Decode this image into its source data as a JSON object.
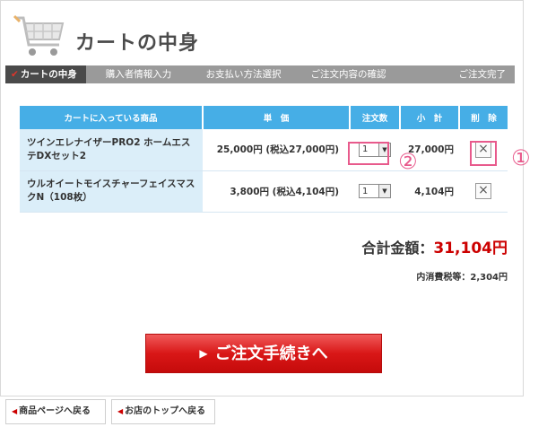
{
  "header": {
    "title": "カートの中身"
  },
  "steps": [
    {
      "label": "カートの中身",
      "active": true
    },
    {
      "label": "購入者情報入力"
    },
    {
      "label": "お支払い方法選択"
    },
    {
      "label": "ご注文内容の確認"
    },
    {
      "label": "ご注文完了"
    }
  ],
  "table": {
    "headers": {
      "product": "カートに入っている商品",
      "unit_price": "単　価",
      "quantity": "注文数",
      "subtotal": "小　計",
      "delete": "削　除"
    },
    "rows": [
      {
        "name": "ツインエレナイザーPRO2 ホームエステDXセット2",
        "price": "25,000円 (税込27,000円)",
        "qty": "1",
        "subtotal": "27,000円"
      },
      {
        "name": "ウルオイートモイスチャーフェイスマスクN（108枚）",
        "price": "3,800円 (税込4,104円)",
        "qty": "1",
        "subtotal": "4,104円"
      }
    ]
  },
  "annotations": {
    "delete_marker": "①",
    "qty_marker": "②"
  },
  "summary": {
    "total_label": "合計金額：",
    "total_value": "31,104円",
    "tax_label": "内消費税等：",
    "tax_value": "2,304円"
  },
  "checkout_button": "ご注文手続きへ",
  "footer_links": {
    "back_product": "商品ページへ戻る",
    "back_top": "お店のトップへ戻る"
  },
  "colors": {
    "header_blue": "#46aee6",
    "name_cell": "#dbeef9",
    "total_red": "#cc0000",
    "highlight_pink": "#e85a8c"
  }
}
